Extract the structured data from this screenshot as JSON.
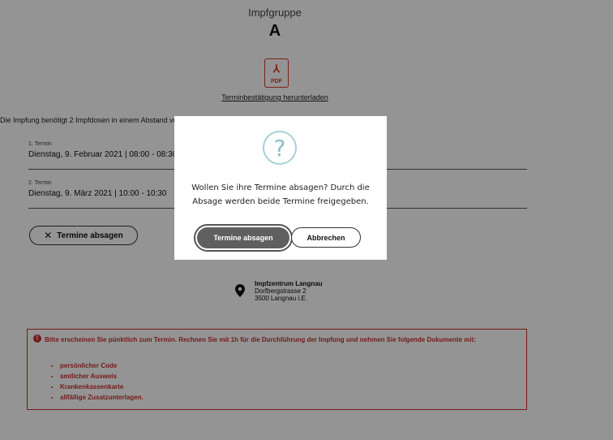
{
  "header": {
    "group_label": "Impfgruppe",
    "group_value": "A"
  },
  "pdf": {
    "icon_label": "PDF",
    "download_link": "Terminbestätigung herunterladen"
  },
  "intro": "Die Impfung benötigt 2 Impfdosen in einem Abstand vo",
  "appointments": [
    {
      "label": "1. Termin",
      "value": "Dienstag, 9. Februar 2021 | 08:00 - 08:30"
    },
    {
      "label": "2. Termin",
      "value": "Dienstag, 9. März 2021 | 10:00 - 10:30"
    }
  ],
  "cancel_button": {
    "label": "Termine absagen"
  },
  "location": {
    "name": "Impfzentrum Langnau",
    "street": "Dorfbergstrasse 2",
    "city": "3500 Langnau i.E."
  },
  "notice": {
    "text": "Bitte erscheinen Sie pünktlich zum Termin. Rechnen Sie mit 1h für die Durchführung der Impfung und nehmen Sie folgende Dokumente mit:",
    "items": [
      "persönlicher Code",
      "amtlicher Ausweis",
      "Krankenkassenkarte",
      "allfällige Zusatzunterlagen."
    ]
  },
  "modal": {
    "icon_glyph": "?",
    "message": "Wollen Sie ihre Termine absagen? Durch die Absage werden beide Termine freigegeben.",
    "confirm_label": "Termine absagen",
    "abort_label": "Abbrechen"
  },
  "colors": {
    "danger": "#c9302c",
    "accent_icon": "#8dbfcb",
    "pdf_red": "#d23a2a",
    "overlay": "rgba(0,0,0,0.42)"
  }
}
